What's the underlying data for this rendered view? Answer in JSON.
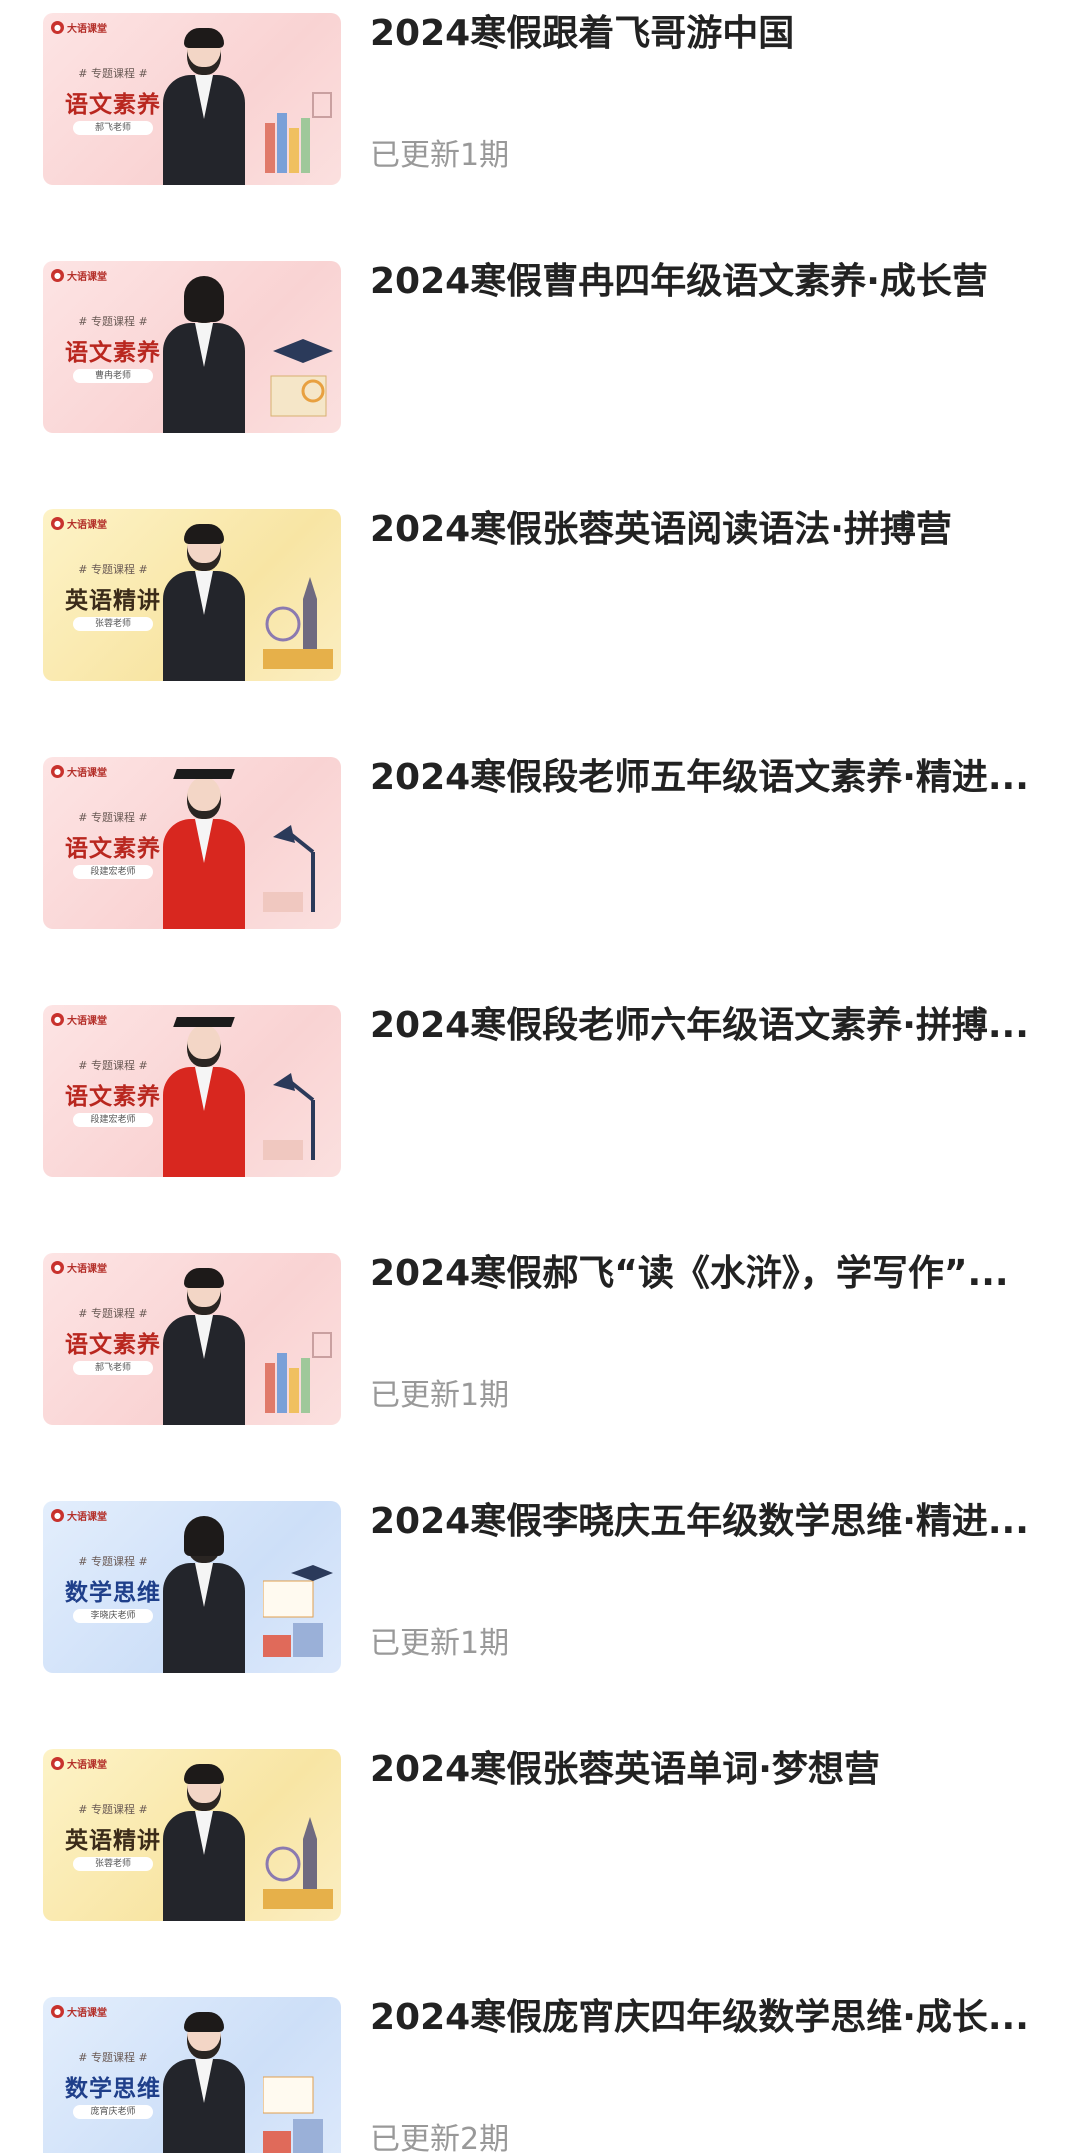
{
  "brand_label": "大语课堂",
  "thumb_tag": "# 专题课程 #",
  "courses": [
    {
      "title": "2024寒假跟着飞哥游中国",
      "update": "已更新1期",
      "subject": "语文素养",
      "teacher": "郝飞老师",
      "theme": "pink"
    },
    {
      "title": "2024寒假曹冉四年级语文素养·成长营",
      "update": "",
      "subject": "语文素养",
      "teacher": "曹冉老师",
      "theme": "pink"
    },
    {
      "title": "2024寒假张蓉英语阅读语法·拼搏营",
      "update": "",
      "subject": "英语精讲",
      "teacher": "张蓉老师",
      "theme": "yellow"
    },
    {
      "title": "2024寒假段老师五年级语文素养·精进...",
      "update": "",
      "subject": "语文素养",
      "teacher": "段建宏老师",
      "theme": "pink"
    },
    {
      "title": "2024寒假段老师六年级语文素养·拼搏...",
      "update": "",
      "subject": "语文素养",
      "teacher": "段建宏老师",
      "theme": "pink"
    },
    {
      "title": "2024寒假郝飞“读《水浒》，学写作”...",
      "update": "已更新1期",
      "subject": "语文素养",
      "teacher": "郝飞老师",
      "theme": "pink"
    },
    {
      "title": "2024寒假李晓庆五年级数学思维·精进...",
      "update": "已更新1期",
      "subject": "数学思维",
      "teacher": "李晓庆老师",
      "theme": "blue"
    },
    {
      "title": "2024寒假张蓉英语单词·梦想营",
      "update": "",
      "subject": "英语精讲",
      "teacher": "张蓉老师",
      "theme": "yellow"
    },
    {
      "title": "2024寒假庞宵庆四年级数学思维·成长...",
      "update": "已更新2期",
      "subject": "数学思维",
      "teacher": "庞宵庆老师",
      "theme": "blue"
    }
  ]
}
